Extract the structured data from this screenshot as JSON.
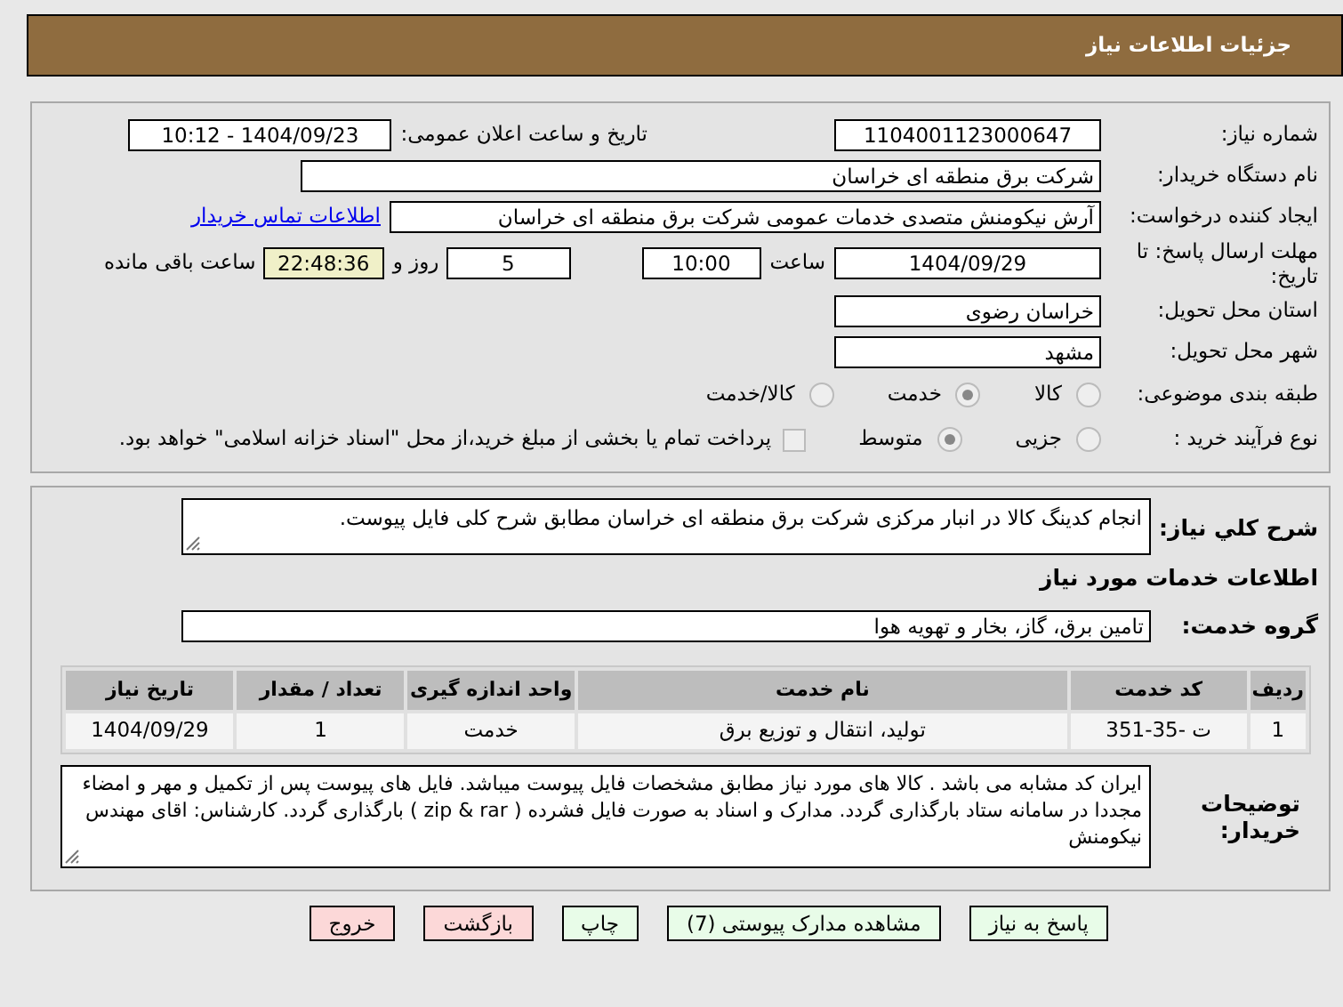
{
  "header": {
    "title": "جزئیات اطلاعات نیاز"
  },
  "details": {
    "need_number": {
      "label": "شماره نیاز:",
      "value": "1104001123000647"
    },
    "announce": {
      "label": "تاریخ و ساعت اعلان عمومی:",
      "value": "1404/09/23 - 10:12"
    },
    "buyer_org": {
      "label": "نام دستگاه خریدار:",
      "value": "شرکت برق منطقه ای خراسان"
    },
    "requester": {
      "label": "ایجاد کننده درخواست:",
      "value": "آرش نیکومنش متصدی خدمات عمومی شرکت برق منطقه ای خراسان",
      "link": "اطلاعات تماس خریدار"
    },
    "deadline": {
      "label": "مهلت ارسال پاسخ: تا تاریخ:",
      "date": "1404/09/29",
      "time_label": "ساعت",
      "time": "10:00",
      "days": "5",
      "days_label": "روز و",
      "remaining": "22:48:36",
      "remaining_label": "ساعت باقی مانده"
    },
    "province": {
      "label": "استان محل تحویل:",
      "value": "خراسان رضوی"
    },
    "city": {
      "label": "شهر محل تحویل:",
      "value": "مشهد"
    },
    "category": {
      "label": "طبقه بندی موضوعی:",
      "options": [
        {
          "label": "کالا",
          "selected": false
        },
        {
          "label": "خدمت",
          "selected": true
        },
        {
          "label": "کالا/خدمت",
          "selected": false
        }
      ]
    },
    "purchase_type": {
      "label": "نوع فرآیند خرید :",
      "options": [
        {
          "label": "جزیی",
          "selected": false
        },
        {
          "label": "متوسط",
          "selected": true
        }
      ],
      "payment": {
        "checked": false,
        "text": "پرداخت تمام یا بخشی از مبلغ خرید،از محل \"اسناد خزانه اسلامی\" خواهد بود."
      }
    }
  },
  "description": {
    "label": "شرح کلي نياز:",
    "value": "انجام کدینگ کالا در انبار مرکزی شرکت برق منطقه ای خراسان مطابق شرح کلی فایل پیوست."
  },
  "services_heading": "اطلاعات خدمات مورد نیاز",
  "service_group": {
    "label": "گروه خدمت:",
    "value": "تامین برق، گاز، بخار و تهویه هوا"
  },
  "table": {
    "columns": [
      "ردیف",
      "کد خدمت",
      "نام خدمت",
      "واحد اندازه گیری",
      "تعداد / مقدار",
      "تاریخ نیاز"
    ],
    "rows": [
      [
        "1",
        "ت -35-351",
        "تولید، انتقال و توزیع برق",
        "خدمت",
        "1",
        "1404/09/29"
      ]
    ]
  },
  "buyer_notes": {
    "label": "توضیحات خریدار:",
    "value": "ایران کد مشابه می باشد . کالا های مورد نیاز مطابق مشخصات فایل پیوست میباشد. فایل های پیوست پس از تکمیل و مهر و امضاء مجددا در سامانه ستاد بارگذاری گردد. مدارک و اسناد به صورت فایل فشرده ( zip & rar ) بارگذاری گردد. کارشناس: اقای مهندس نیکومنش"
  },
  "buttons": [
    {
      "label": "پاسخ به نیاز",
      "kind": "action"
    },
    {
      "label": "مشاهده مدارک پیوستی (7)",
      "kind": "action"
    },
    {
      "label": "چاپ",
      "kind": "action"
    },
    {
      "label": "بازگشت",
      "kind": "exit"
    },
    {
      "label": "خروج",
      "kind": "exit"
    }
  ]
}
